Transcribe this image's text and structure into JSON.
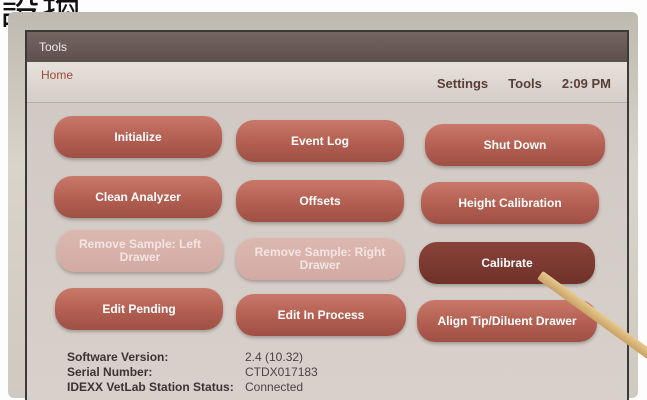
{
  "caption": "設換",
  "window": {
    "title": "Tools"
  },
  "nav": {
    "home": "Home",
    "settings": "Settings",
    "tools": "Tools",
    "time": "2:09 PM"
  },
  "buttons": {
    "initialize": "Initialize",
    "event_log": "Event Log",
    "shut_down": "Shut Down",
    "clean_analyzer": "Clean Analyzer",
    "offsets": "Offsets",
    "height_calibration": "Height Calibration",
    "remove_left": "Remove Sample: Left Drawer",
    "remove_right": "Remove Sample: Right Drawer",
    "calibrate": "Calibrate",
    "edit_pending": "Edit Pending",
    "edit_in_process": "Edit In Process",
    "align_tip": "Align Tip/Diluent Drawer"
  },
  "info": {
    "software_label": "Software Version:",
    "software_value": "2.4 (10.32)",
    "serial_label": "Serial Number:",
    "serial_value": "CTDX017183",
    "status_label": "IDEXX VetLab Station Status:",
    "status_value": "Connected"
  }
}
